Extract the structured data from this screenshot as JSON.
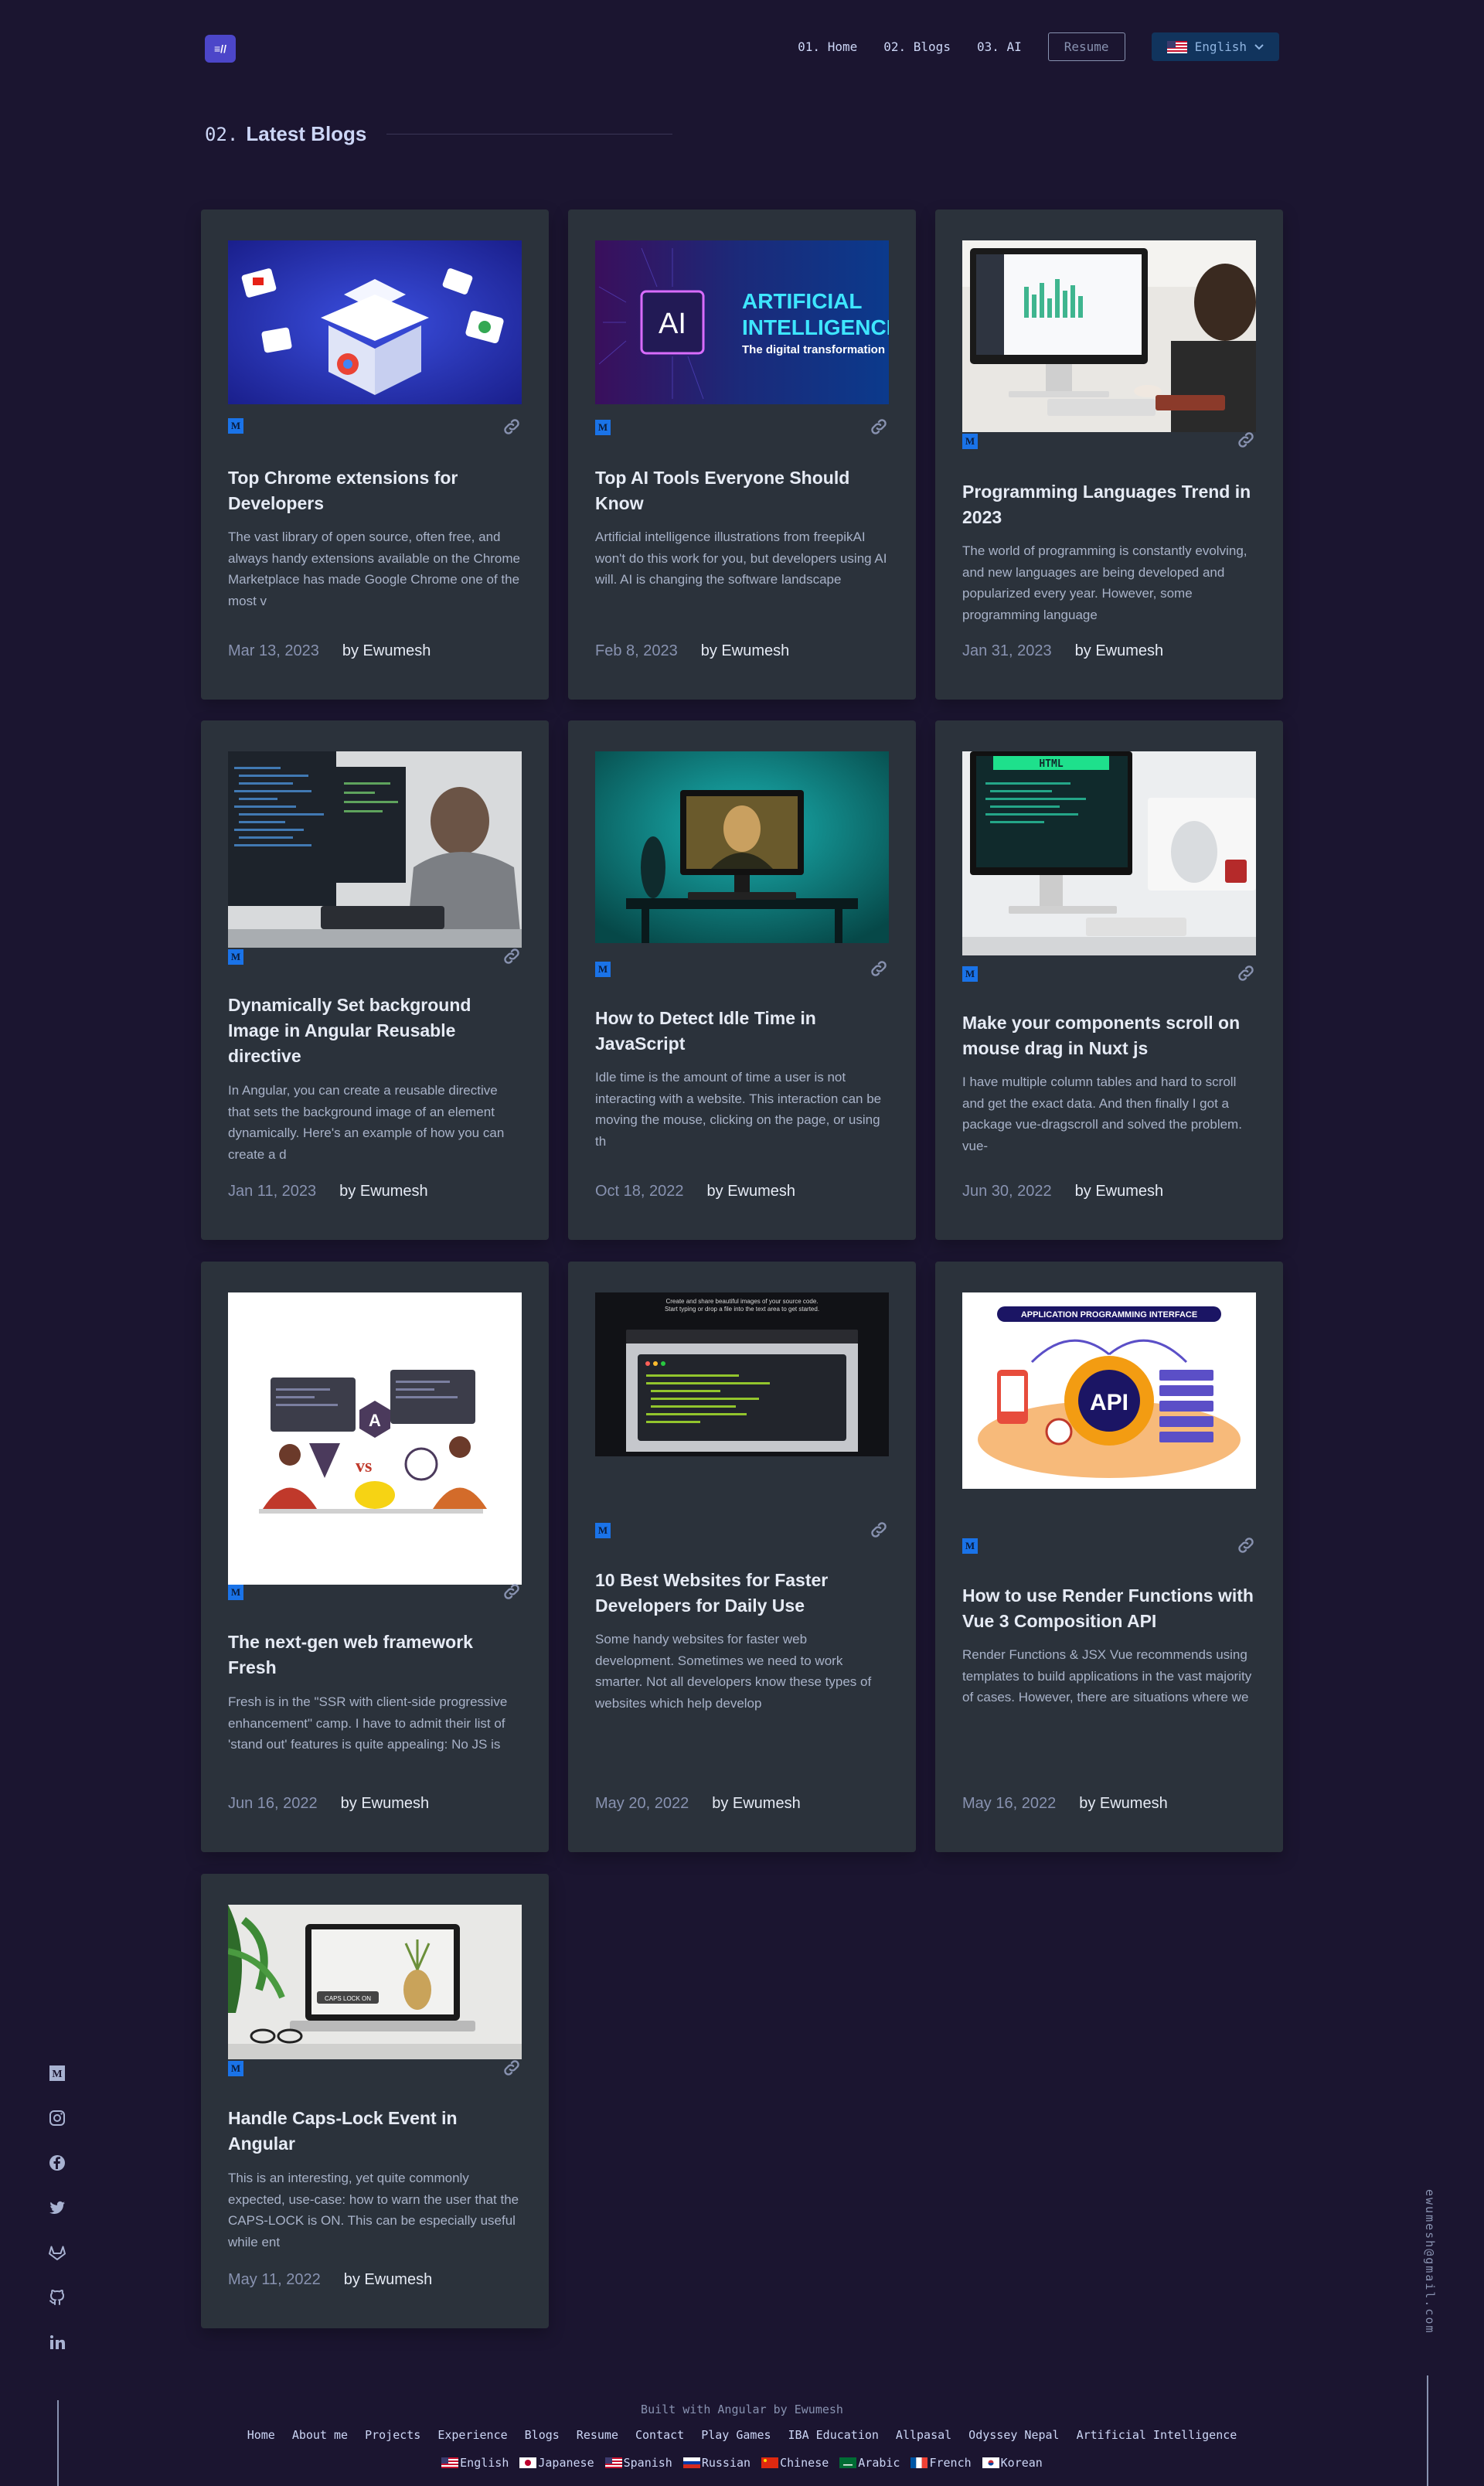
{
  "header": {
    "logo_text": "≡//",
    "nav": [
      {
        "num": "01.",
        "label": "Home"
      },
      {
        "num": "02.",
        "label": "Blogs"
      },
      {
        "num": "03.",
        "label": "AI"
      }
    ],
    "resume_label": "Resume",
    "language_label": "English"
  },
  "section": {
    "num": "02.",
    "title": "Latest Blogs"
  },
  "card_badge": "M",
  "posts": [
    {
      "title": "Top Chrome extensions for Developers",
      "desc": "The vast library of open source, often free, and always handy extensions available on the Chrome Marketplace has made Google Chrome one of the most v",
      "date": "Mar 13, 2023",
      "author": "by Ewumesh",
      "image": "chrome-extensions-illustration"
    },
    {
      "title": "Top AI Tools Everyone Should Know",
      "desc": "Artificial intelligence illustrations from freepikAI won't do this work for you, but developers using AI will. AI is changing the software landscape",
      "date": "Feb 8, 2023",
      "author": "by Ewumesh",
      "image": "ai-chip-banner",
      "image_text": {
        "chip": "AI",
        "line1": "ARTIFICIAL",
        "line2": "INTELLIGENCE",
        "line3": "The digital transformation"
      }
    },
    {
      "title": "Programming Languages Trend in 2023",
      "desc": "The world of programming is constantly evolving, and new languages are being developed and popularized every year. However, some programming language",
      "date": "Jan 31, 2023",
      "author": "by Ewumesh",
      "image": "analytics-desk-photo"
    },
    {
      "title": "Dynamically Set background Image in Angular Reusable directive",
      "desc": "In Angular, you can create a reusable directive that sets the background image of an element dynamically. Here's an example of how you can create a d",
      "date": "Jan 11, 2023",
      "author": "by Ewumesh",
      "image": "developer-coding-photo"
    },
    {
      "title": "How to Detect Idle Time in JavaScript",
      "desc": "Idle time is the amount of time a user is not interacting with a website. This interaction can be moving the mouse, clicking on the page, or using th",
      "date": "Oct 18, 2022",
      "author": "by Ewumesh",
      "image": "mona-lisa-monitor-photo"
    },
    {
      "title": "Make your components scroll on mouse drag in Nuxt js",
      "desc": "I have multiple column tables and hard to scroll and get the exact data. And then finally I got a package vue-dragscroll and solved the problem. vue-",
      "date": "Jun 30, 2022",
      "author": "by Ewumesh",
      "image": "html-desk-photo",
      "image_text": {
        "screen": "HTML"
      }
    },
    {
      "title": "The next-gen web framework Fresh",
      "desc": "Fresh is in the \"SSR with client-side progressive enhancement\" camp. I have to admit their list of 'stand out' features is quite appealing: No JS is",
      "date": "Jun 16, 2022",
      "author": "by Ewumesh",
      "image": "framework-vs-illustration",
      "image_text": {
        "vs": "vs",
        "logo": "A"
      }
    },
    {
      "title": "10 Best Websites for Faster Developers for Daily Use",
      "desc": "Some handy websites for faster web development. Sometimes we need to work smarter. Not all developers know these types of websites which help develop",
      "date": "May 20, 2022",
      "author": "by Ewumesh",
      "image": "code-snippet-screenshot",
      "image_text": {
        "line1": "Create and share beautiful images of your source code.",
        "line2": "Start typing or drop a file into the text area to get started."
      }
    },
    {
      "title": "How to use Render Functions with Vue 3 Composition API",
      "desc": "Render Functions & JSX Vue recommends using templates to build applications in the vast majority of cases. However, there are situations where we",
      "date": "May 16, 2022",
      "author": "by Ewumesh",
      "image": "api-illustration",
      "image_text": {
        "banner": "APPLICATION PROGRAMMING INTERFACE",
        "gear": "API"
      }
    },
    {
      "title": "Handle Caps-Lock Event in Angular",
      "desc": "This is an interesting, yet quite commonly expected, use-case: how to warn the user that the CAPS-LOCK is ON. This can be especially useful while ent",
      "date": "May 11, 2022",
      "author": "by Ewumesh",
      "image": "laptop-caps-lock-photo",
      "image_text": {
        "label": "CAPS LOCK ON"
      }
    }
  ],
  "social": [
    "medium-icon",
    "instagram-icon",
    "facebook-icon",
    "twitter-icon",
    "gitlab-icon",
    "github-icon",
    "linkedin-icon"
  ],
  "email": "ewumesh@gmail.com",
  "footer": {
    "built": "Built with Angular by Ewumesh",
    "links": [
      "Home",
      "About me",
      "Projects",
      "Experience",
      "Blogs",
      "Resume",
      "Contact",
      "Play Games",
      "IBA Education",
      "Allpasal",
      "Odyssey Nepal",
      "Artificial Intelligence"
    ],
    "languages": [
      {
        "label": "English",
        "flag": "us-flag"
      },
      {
        "label": "Japanese",
        "flag": "japan-flag"
      },
      {
        "label": "Spanish",
        "flag": "us-flag"
      },
      {
        "label": "Russian",
        "flag": "russia-flag"
      },
      {
        "label": "Chinese",
        "flag": "china-flag"
      },
      {
        "label": "Arabic",
        "flag": "saudi-flag"
      },
      {
        "label": "French",
        "flag": "france-flag"
      },
      {
        "label": "Korean",
        "flag": "korea-flag"
      }
    ]
  }
}
